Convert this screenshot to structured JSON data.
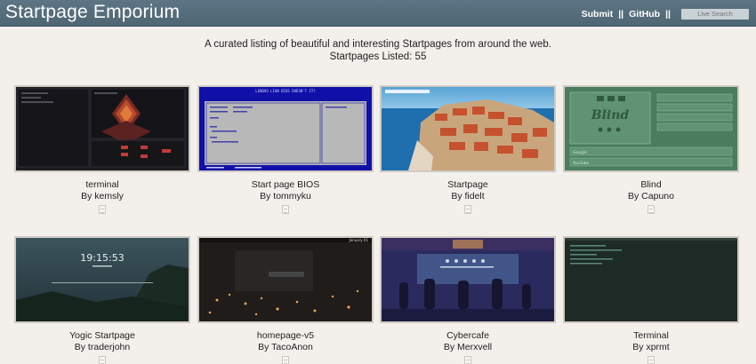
{
  "header": {
    "brand": "Startpage Emporium",
    "nav": {
      "submit": "Submit",
      "github": "GitHub",
      "separator": "||"
    },
    "search": {
      "placeholder": "Live Search"
    }
  },
  "intro": {
    "tagline": "A curated listing of beautiful and interesting Startpages from around the web.",
    "count_text": "Startpages Listed: 55"
  },
  "cards": [
    {
      "title": "terminal",
      "author": "By kemsly"
    },
    {
      "title": "Start page BIOS",
      "author": "By tommyku"
    },
    {
      "title": "Startpage",
      "author": "By fidelt"
    },
    {
      "title": "Blind",
      "author": "By Capuno"
    },
    {
      "title": "Yogic Startpage",
      "author": "By traderjohn"
    },
    {
      "title": "homepage-v5",
      "author": "By TacoAnon"
    },
    {
      "title": "Cybercafe",
      "author": "By Merxvell"
    },
    {
      "title": "Terminal",
      "author": "By xprmt"
    }
  ],
  "thumb_text": {
    "bios_header": "LENOVO LION BIOS DOESN'T IT?",
    "blind_logo": "Blind",
    "blind_links": [
      "Google",
      "YouTube"
    ],
    "yogic_time": "19:15:53",
    "homepage_date": "January 01"
  },
  "icons": {
    "file": "file-icon"
  }
}
